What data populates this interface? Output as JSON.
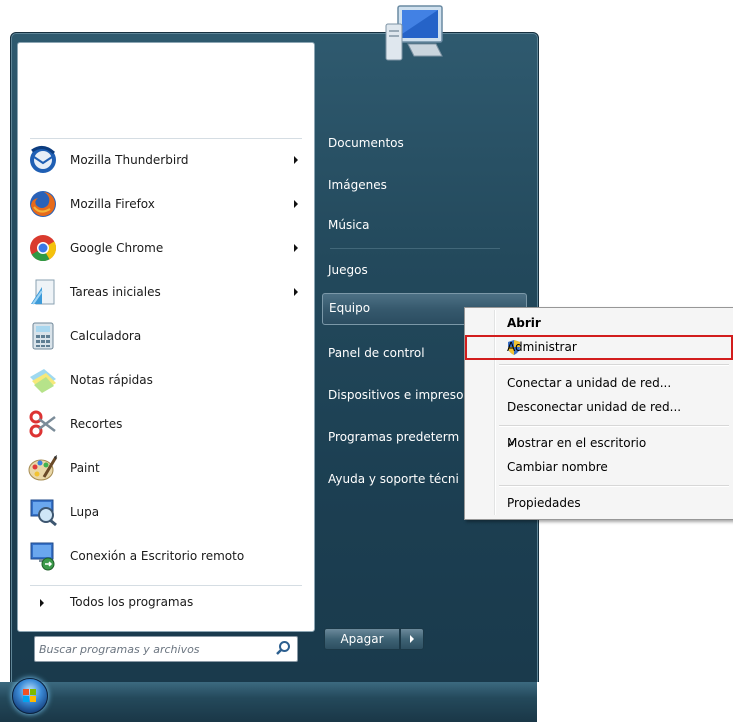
{
  "programs": [
    {
      "label": "Mozilla Thunderbird",
      "icon": "thunderbird-icon",
      "submenu": true
    },
    {
      "label": "Mozilla Firefox",
      "icon": "firefox-icon",
      "submenu": true
    },
    {
      "label": "Google Chrome",
      "icon": "chrome-icon",
      "submenu": true
    },
    {
      "label": "Tareas iniciales",
      "icon": "getting-started-icon",
      "submenu": true
    },
    {
      "label": "Calculadora",
      "icon": "calculator-icon",
      "submenu": false
    },
    {
      "label": "Notas rápidas",
      "icon": "sticky-notes-icon",
      "submenu": false
    },
    {
      "label": "Recortes",
      "icon": "snipping-tool-icon",
      "submenu": false
    },
    {
      "label": "Paint",
      "icon": "paint-icon",
      "submenu": false
    },
    {
      "label": "Lupa",
      "icon": "magnifier-icon",
      "submenu": false
    },
    {
      "label": "Conexión a Escritorio remoto",
      "icon": "remote-desktop-icon",
      "submenu": false
    }
  ],
  "all_programs_label": "Todos los programas",
  "search": {
    "placeholder": "Buscar programas y archivos"
  },
  "right_panel": {
    "items": [
      {
        "label": "Documentos"
      },
      {
        "label": "Imágenes"
      },
      {
        "label": "Música"
      },
      {
        "label": "Juegos"
      },
      {
        "label": "Equipo"
      },
      {
        "label": "Panel de control"
      },
      {
        "label": "Dispositivos e impreso"
      },
      {
        "label": "Programas predeterm"
      },
      {
        "label": "Ayuda y soporte técni"
      }
    ]
  },
  "shutdown": {
    "label": "Apagar"
  },
  "context_menu": {
    "items": [
      {
        "label": "Abrir",
        "bold": true
      },
      {
        "label": "Administrar",
        "icon": "uac-shield-icon"
      },
      {
        "label": "Conectar a unidad de red..."
      },
      {
        "label": "Desconectar unidad de red..."
      },
      {
        "label": "Mostrar en el escritorio",
        "checked": true
      },
      {
        "label": "Cambiar nombre"
      },
      {
        "label": "Propiedades"
      }
    ]
  },
  "colors": {
    "menu_background": "#23495c",
    "highlight_border": "#d21d1d",
    "check_color": "#2f6ebd"
  }
}
